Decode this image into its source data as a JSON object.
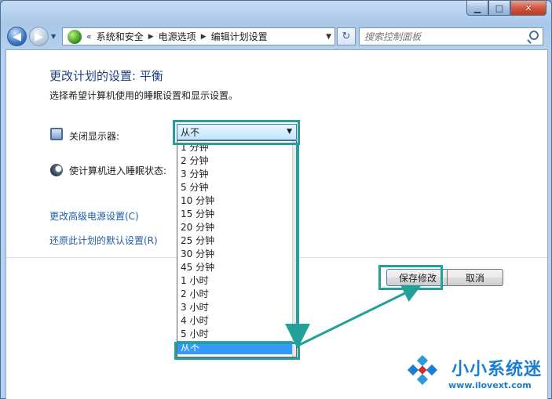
{
  "caption": {
    "min_glyph": "▁",
    "max_glyph": "□",
    "close_glyph": "✕"
  },
  "nav": {
    "back_glyph": "◀",
    "forward_glyph": "▶",
    "history_glyph": "▼",
    "address": {
      "chevron": "«",
      "crumbs": [
        "系统和安全",
        "电源选项",
        "编辑计划设置"
      ],
      "sep_glyph": "▶",
      "drop_glyph": "▼"
    },
    "refresh_glyph": "↻",
    "search_placeholder": "搜索控制面板"
  },
  "main": {
    "title": "更改计划的设置: 平衡",
    "subtitle": "选择希望计算机使用的睡眠设置和显示设置。",
    "display_label": "关闭显示器:",
    "sleep_label": "使计算机进入睡眠状态:",
    "select_value": "从不",
    "select_arrow": "▼",
    "options": [
      "1 分钟",
      "2 分钟",
      "3 分钟",
      "5 分钟",
      "10 分钟",
      "15 分钟",
      "20 分钟",
      "25 分钟",
      "30 分钟",
      "45 分钟",
      "1 小时",
      "2 小时",
      "3 小时",
      "4 小时",
      "5 小时",
      "从不"
    ],
    "selected_option": "从不",
    "links": [
      "更改高级电源设置(C)",
      "还原此计划的默认设置(R)"
    ],
    "save_label": "保存修改",
    "cancel_label": "取消"
  },
  "watermark": {
    "name": "小小系统迷",
    "url": "www.ilovext.com"
  },
  "colors": {
    "annotation": "#23a09a",
    "selection": "#3399ff",
    "link": "#1f5da8",
    "title": "#1e3f7c"
  }
}
